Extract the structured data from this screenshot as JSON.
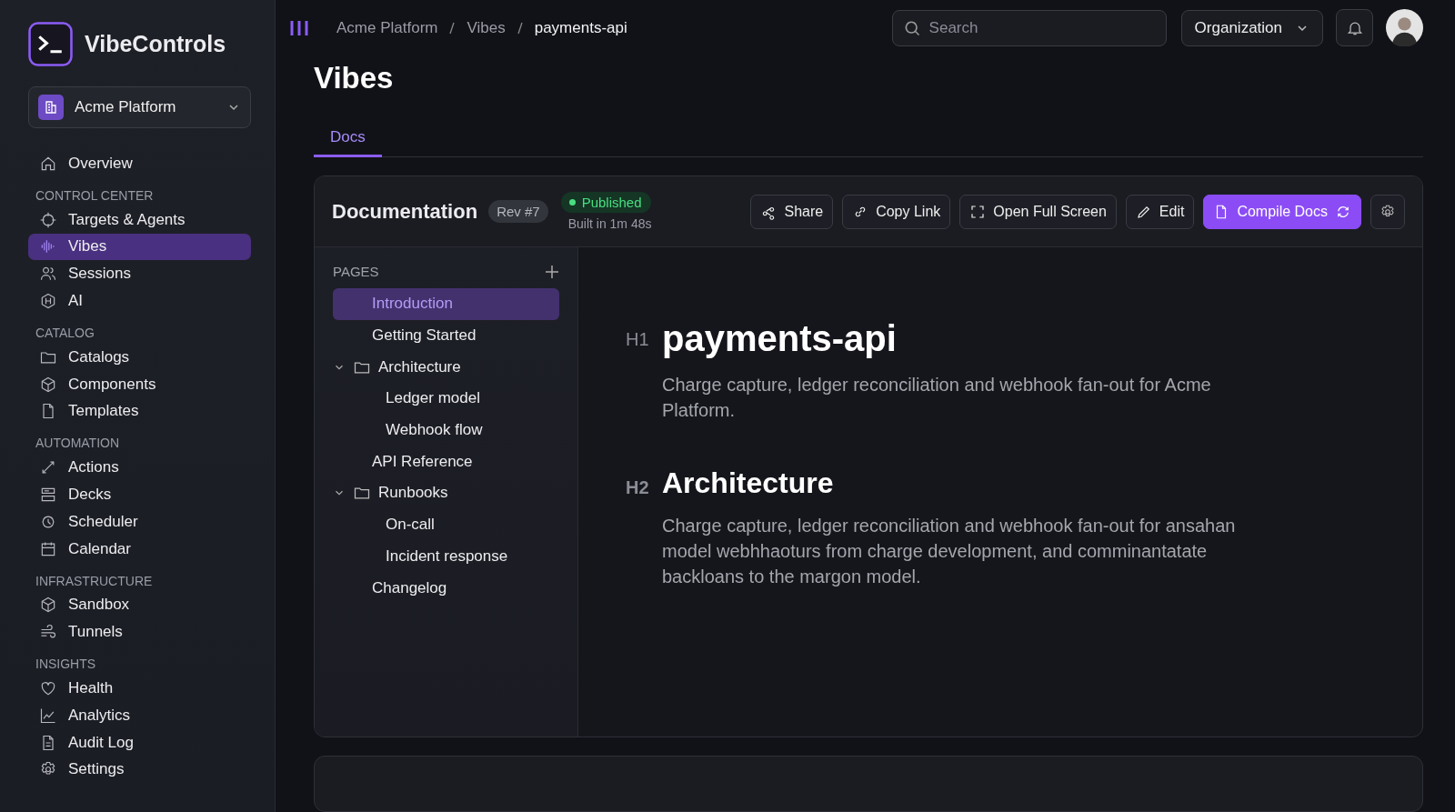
{
  "app": {
    "name": "VibeControls"
  },
  "workspace": {
    "name": "Acme Platform"
  },
  "nav_top": {
    "label": "Overview",
    "selected": false
  },
  "nav_sections": [
    {
      "title": "CONTROL CENTER",
      "items": [
        {
          "label": "Targets & Agents",
          "selected": false
        },
        {
          "label": "Vibes",
          "selected": true
        },
        {
          "label": "Sessions",
          "selected": false
        },
        {
          "label": "AI",
          "selected": false
        }
      ]
    },
    {
      "title": "CATALOG",
      "items": [
        {
          "label": "Catalogs",
          "selected": false
        },
        {
          "label": "Components",
          "selected": false
        },
        {
          "label": "Templates",
          "selected": false
        }
      ]
    },
    {
      "title": "AUTOMATION",
      "items": [
        {
          "label": "Actions",
          "selected": false
        },
        {
          "label": "Decks",
          "selected": false
        },
        {
          "label": "Scheduler",
          "selected": false
        },
        {
          "label": "Calendar",
          "selected": false
        }
      ]
    },
    {
      "title": "INFRASTRUCTURE",
      "items": [
        {
          "label": "Sandbox",
          "selected": false
        },
        {
          "label": "Tunnels",
          "selected": false
        }
      ]
    },
    {
      "title": "INSIGHTS",
      "items": [
        {
          "label": "Health",
          "selected": false
        },
        {
          "label": "Analytics",
          "selected": false
        },
        {
          "label": "Audit Log",
          "selected": false
        },
        {
          "label": "Settings",
          "selected": false
        }
      ]
    }
  ],
  "breadcrumb": [
    "Acme Platform",
    "Vibes",
    "payments-api"
  ],
  "search": {
    "placeholder": "Search"
  },
  "organization": {
    "label": "Organization"
  },
  "page_title": "Vibes",
  "tabs": [
    {
      "label": "Docs",
      "selected": true
    }
  ],
  "doc_card": {
    "title": "Documentation",
    "revision": "Rev #7",
    "status": "Published",
    "build_info": "Built in 1m 48s",
    "actions": [
      {
        "label": "Share",
        "kind": "share"
      },
      {
        "label": "Copy Link",
        "kind": "link"
      },
      {
        "label": "Open Full Screen",
        "kind": "fullscreen"
      },
      {
        "label": "Edit",
        "kind": "edit"
      },
      {
        "label": "Compile Docs",
        "kind": "primary"
      }
    ],
    "pages_heading": "PAGES",
    "pages": [
      {
        "label": "Introduction",
        "selected": true
      },
      {
        "label": "Getting Started",
        "selected": false
      },
      {
        "label": "Architecture",
        "selected": false,
        "expanded": true,
        "children": [
          {
            "label": "Ledger model",
            "selected": false
          },
          {
            "label": "Webhook flow",
            "selected": false
          }
        ]
      },
      {
        "label": "API Reference",
        "selected": false
      },
      {
        "label": "Runbooks",
        "selected": false,
        "expanded": true,
        "children": [
          {
            "label": "On-call",
            "selected": false
          },
          {
            "label": "Incident response",
            "selected": false
          }
        ]
      },
      {
        "label": "Changelog",
        "selected": false
      }
    ],
    "content": [
      {
        "marker": "H1",
        "heading": "payments-api",
        "text": "Charge capture, ledger reconciliation and webhook fan-out for Acme Platform."
      },
      {
        "marker": "H2",
        "heading": "Architecture",
        "text": "Charge capture, ledger reconciliation and webhook fan-out for ansahan model webhhaoturs from charge development, and comminantatate backloans to the margon model."
      }
    ]
  }
}
